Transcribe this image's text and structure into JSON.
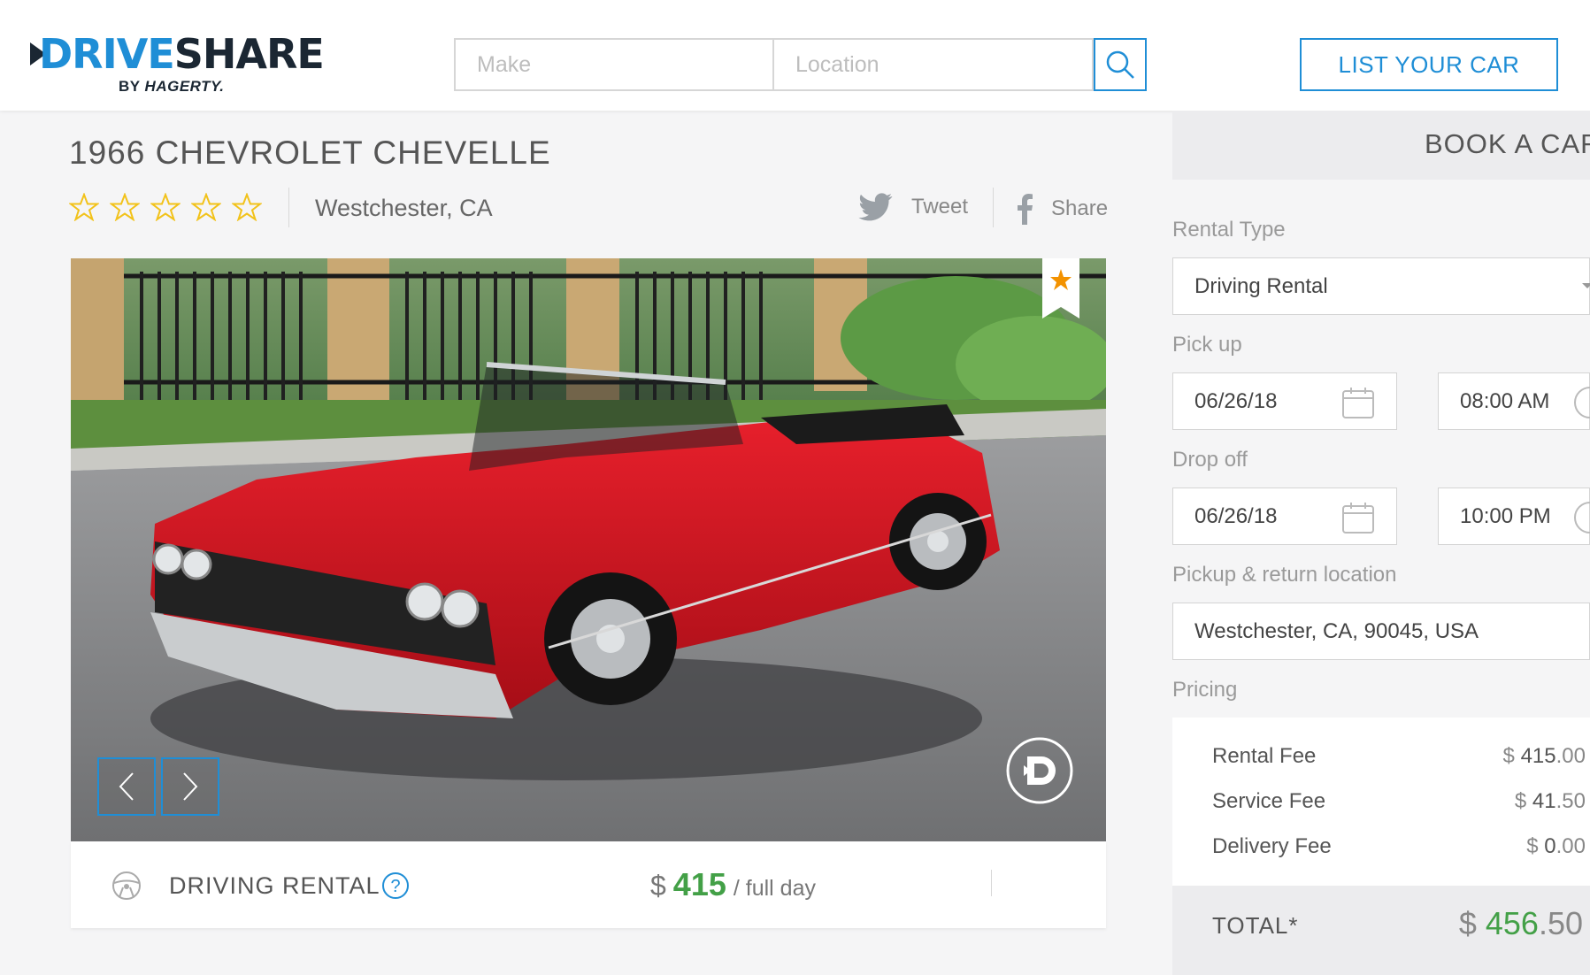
{
  "header": {
    "logo_drive": "DRIVE",
    "logo_share": "SHARE",
    "logo_by": "BY",
    "logo_brand": "HAGERTY.",
    "make_placeholder": "Make",
    "location_placeholder": "Location",
    "list_car_label": "LIST YOUR CAR"
  },
  "listing": {
    "title": "1966 CHEVROLET CHEVELLE",
    "rating_stars": 0,
    "rating_max": 5,
    "location": "Westchester, CA",
    "tweet_label": "Tweet",
    "share_label": "Share",
    "rental_type_label": "DRIVING RENTAL",
    "price_currency": "$",
    "price_amount": "415",
    "price_unit": "/ full day"
  },
  "booking": {
    "header": "BOOK A CAR",
    "rental_type_label": "Rental Type",
    "rental_type_value": "Driving Rental",
    "pickup_label": "Pick up",
    "pickup_date": "06/26/18",
    "pickup_time": "08:00 AM",
    "dropoff_label": "Drop off",
    "dropoff_date": "06/26/18",
    "dropoff_time": "10:00 PM",
    "location_label": "Pickup & return location",
    "location_value": "Westchester, CA, 90045, USA",
    "pricing_label": "Pricing",
    "fees": [
      {
        "label": "Rental Fee",
        "cur": "$",
        "whole": "415",
        "cents": ".00"
      },
      {
        "label": "Service Fee",
        "cur": "$",
        "whole": "41",
        "cents": ".50"
      },
      {
        "label": "Delivery Fee",
        "cur": "$",
        "whole": "0",
        "cents": ".00"
      }
    ],
    "total_label": "TOTAL*",
    "total_cur": "$",
    "total_whole": "456",
    "total_cents": ".50"
  },
  "colors": {
    "accent": "#1f8ed6",
    "price_green": "#43a047",
    "star": "#f2c21a",
    "ribbon_star": "#f39200"
  },
  "icons": [
    "search-icon",
    "star-outline-icon",
    "twitter-icon",
    "facebook-icon",
    "steering-wheel-icon",
    "help-icon",
    "chevron-left-icon",
    "chevron-right-icon",
    "calendar-icon",
    "clock-icon",
    "chevron-down-icon"
  ]
}
